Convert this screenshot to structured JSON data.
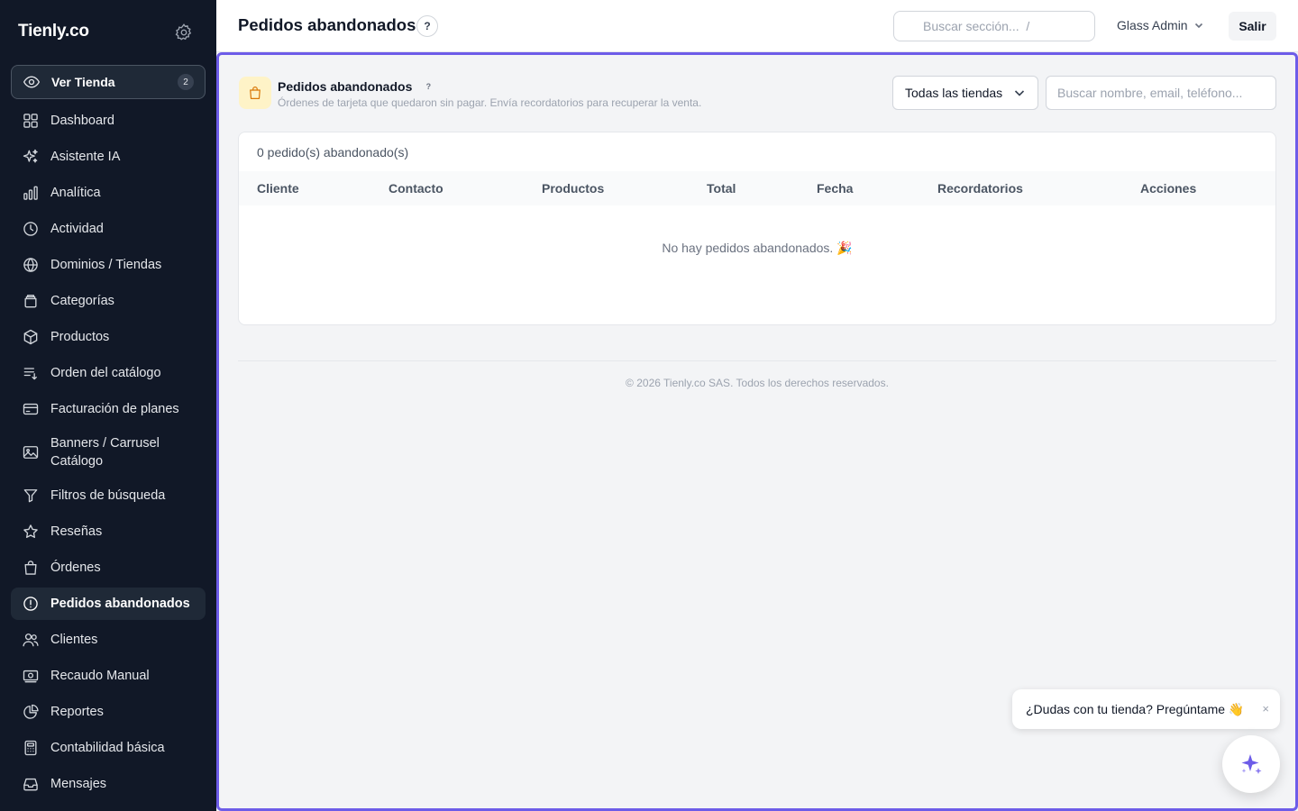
{
  "brand": {
    "name": "Tienly.co"
  },
  "sidebar": {
    "ver_tienda": {
      "label": "Ver Tienda",
      "badge": "2"
    },
    "items": [
      {
        "label": "Dashboard",
        "icon": "grid-icon"
      },
      {
        "label": "Asistente IA",
        "icon": "sparkles-icon"
      },
      {
        "label": "Analítica",
        "icon": "bar-chart-icon"
      },
      {
        "label": "Actividad",
        "icon": "clock-icon"
      },
      {
        "label": "Dominios / Tiendas",
        "icon": "globe-icon"
      },
      {
        "label": "Categorías",
        "icon": "archive-icon"
      },
      {
        "label": "Productos",
        "icon": "cube-icon"
      },
      {
        "label": "Orden del catálogo",
        "icon": "list-order-icon"
      },
      {
        "label": "Facturación de planes",
        "icon": "credit-card-icon"
      },
      {
        "label": "Banners / Carrusel Catálogo",
        "icon": "image-icon"
      },
      {
        "label": "Filtros de búsqueda",
        "icon": "filter-icon"
      },
      {
        "label": "Reseñas",
        "icon": "star-icon"
      },
      {
        "label": "Órdenes",
        "icon": "shopping-bag-icon"
      },
      {
        "label": "Pedidos abandonados",
        "icon": "alert-circle-icon",
        "active": true
      },
      {
        "label": "Clientes",
        "icon": "users-icon"
      },
      {
        "label": "Recaudo Manual",
        "icon": "cash-icon"
      },
      {
        "label": "Reportes",
        "icon": "pie-chart-icon"
      },
      {
        "label": "Contabilidad básica",
        "icon": "calculator-icon"
      },
      {
        "label": "Mensajes",
        "icon": "inbox-icon"
      }
    ]
  },
  "header": {
    "title": "Pedidos abandonados",
    "help": "?",
    "search_placeholder": "Buscar sección...  /",
    "user": "Glass Admin",
    "logout": "Salir"
  },
  "section": {
    "title": "Pedidos abandonados",
    "help": "?",
    "subtitle": "Órdenes de tarjeta que quedaron sin pagar. Envía recordatorios para recuperar la venta.",
    "store_filter": "Todas las tiendas",
    "search_placeholder": "Buscar nombre, email, teléfono..."
  },
  "table": {
    "count": "0 pedido(s) abandonado(s)",
    "columns": [
      "Cliente",
      "Contacto",
      "Productos",
      "Total",
      "Fecha",
      "Recordatorios",
      "Acciones"
    ],
    "empty": "No hay pedidos abandonados. 🎉"
  },
  "footer": {
    "copyright": "© 2026 Tienly.co SAS. Todos los derechos reservados."
  },
  "chat": {
    "prompt": "¿Dudas con tu tienda? Pregúntame 👋",
    "close": "×"
  },
  "colors": {
    "sidebar_bg": "#111827",
    "accent": "#6d5ce8",
    "warning_bg": "#fef3c7",
    "warning": "#d97706"
  }
}
